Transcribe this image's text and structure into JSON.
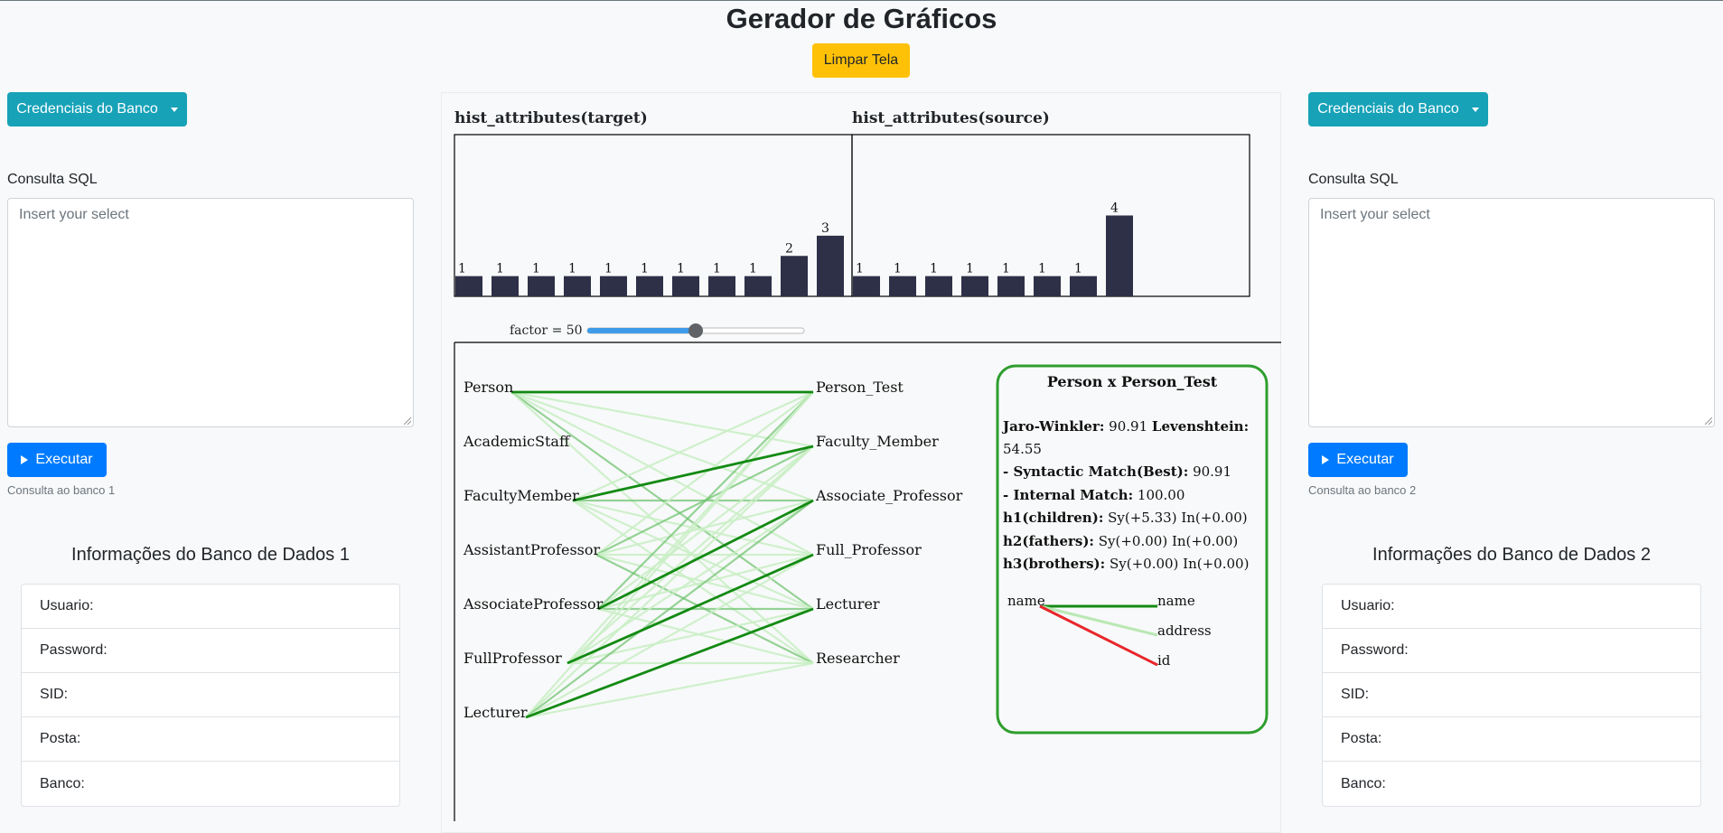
{
  "title": "Gerador de Gráficos",
  "clear_button": "Limpar Tela",
  "left": {
    "credentials_button": "Credenciais do Banco",
    "sql_label": "Consulta SQL",
    "sql_placeholder": "Insert your select",
    "execute_button": "Executar",
    "note": "Consulta ao banco 1",
    "info_title": "Informações do Banco de Dados 1",
    "info_items": [
      "Usuario:",
      "Password:",
      "SID:",
      "Posta:",
      "Banco:"
    ]
  },
  "right": {
    "credentials_button": "Credenciais do Banco",
    "sql_label": "Consulta SQL",
    "sql_placeholder": "Insert your select",
    "execute_button": "Executar",
    "note": "Consulta ao banco 2",
    "info_title": "Informações do Banco de Dados 2",
    "info_items": [
      "Usuario:",
      "Password:",
      "SID:",
      "Posta:",
      "Banco:"
    ]
  },
  "factor": {
    "label": "factor = 50",
    "value": 50,
    "min": 0,
    "max": 100
  },
  "chart_data": [
    {
      "type": "bar",
      "title": "hist_attributes(target)",
      "values": [
        1,
        1,
        1,
        1,
        1,
        1,
        1,
        1,
        1,
        2,
        3
      ],
      "ylim": [
        0,
        8
      ],
      "bar_color": "#2d3047"
    },
    {
      "type": "bar",
      "title": "hist_attributes(source)",
      "values": [
        1,
        1,
        1,
        1,
        1,
        1,
        1,
        4
      ],
      "ylim": [
        0,
        8
      ],
      "bar_color": "#2d3047"
    }
  ],
  "matching": {
    "left_nodes": [
      "Person",
      "AcademicStaff",
      "FacultyMember",
      "AssistantProfessor",
      "AssociateProfessor",
      "FullProfessor",
      "Lecturer"
    ],
    "right_nodes": [
      "Person_Test",
      "Faculty_Member",
      "Associate_Professor",
      "Full_Professor",
      "Lecturer",
      "Researcher"
    ],
    "best_links": [
      [
        0,
        0
      ],
      [
        2,
        1
      ],
      [
        4,
        2
      ],
      [
        5,
        3
      ],
      [
        6,
        4
      ]
    ],
    "colors": {
      "best": "#138a13",
      "medium": "#6cc26c",
      "weak": "#c9efc4",
      "mismatch": "#e8262a",
      "border": "#2e9e2e"
    }
  },
  "detail": {
    "title": "Person x Person_Test",
    "jw_label": "Jaro-Winkler:",
    "jw_value": "90.91",
    "lev_label": "Levenshtein:",
    "lev_value": "54.55",
    "syn_label": "- Syntactic Match(Best):",
    "syn_value": "90.91",
    "int_label": "- Internal Match:",
    "int_value": "100.00",
    "h1_label": "h1(children):",
    "h1_value": "Sy(+5.33) In(+0.00)",
    "h2_label": "h2(fathers):",
    "h2_value": "Sy(+0.00) In(+0.00)",
    "h3_label": "h3(brothers):",
    "h3_value": "Sy(+0.00) In(+0.00)",
    "attr_left": [
      "name"
    ],
    "attr_right": [
      "name",
      "address",
      "id"
    ]
  }
}
